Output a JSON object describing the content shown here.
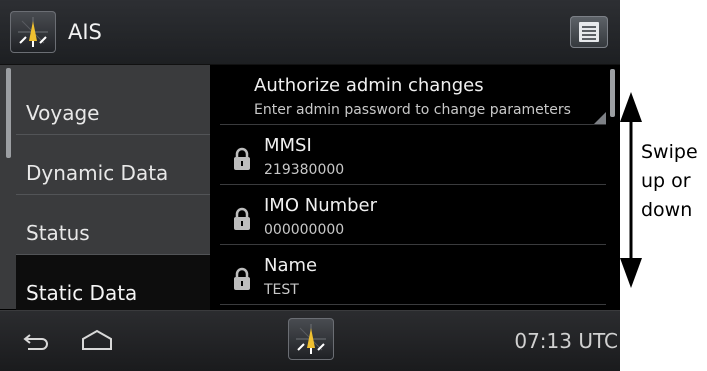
{
  "app": {
    "title": "AIS",
    "icon": "ais-compass-icon"
  },
  "menu": {
    "icon": "menu-list-icon"
  },
  "left_nav": {
    "items": [
      {
        "label": "Voyage",
        "selected": false
      },
      {
        "label": "Dynamic Data",
        "selected": false
      },
      {
        "label": "Status",
        "selected": false
      },
      {
        "label": "Static Data",
        "selected": true
      }
    ]
  },
  "settings": {
    "items": [
      {
        "title": "Authorize admin changes",
        "subtitle": "Enter admin password to change parameters",
        "locked": false
      },
      {
        "title": "MMSI",
        "subtitle": "219380000",
        "locked": true
      },
      {
        "title": "IMO Number",
        "subtitle": "000000000",
        "locked": true
      },
      {
        "title": "Name",
        "subtitle": "TEST",
        "locked": true
      }
    ]
  },
  "status_bar": {
    "time": "07:13 UTC"
  },
  "annotation": {
    "line1": "Swipe",
    "line2": "up or",
    "line3": "down"
  },
  "colors": {
    "background": "#000000",
    "panel": "#3a3b3d",
    "text": "#f0f0f0",
    "selected": "#0d0d0d"
  }
}
